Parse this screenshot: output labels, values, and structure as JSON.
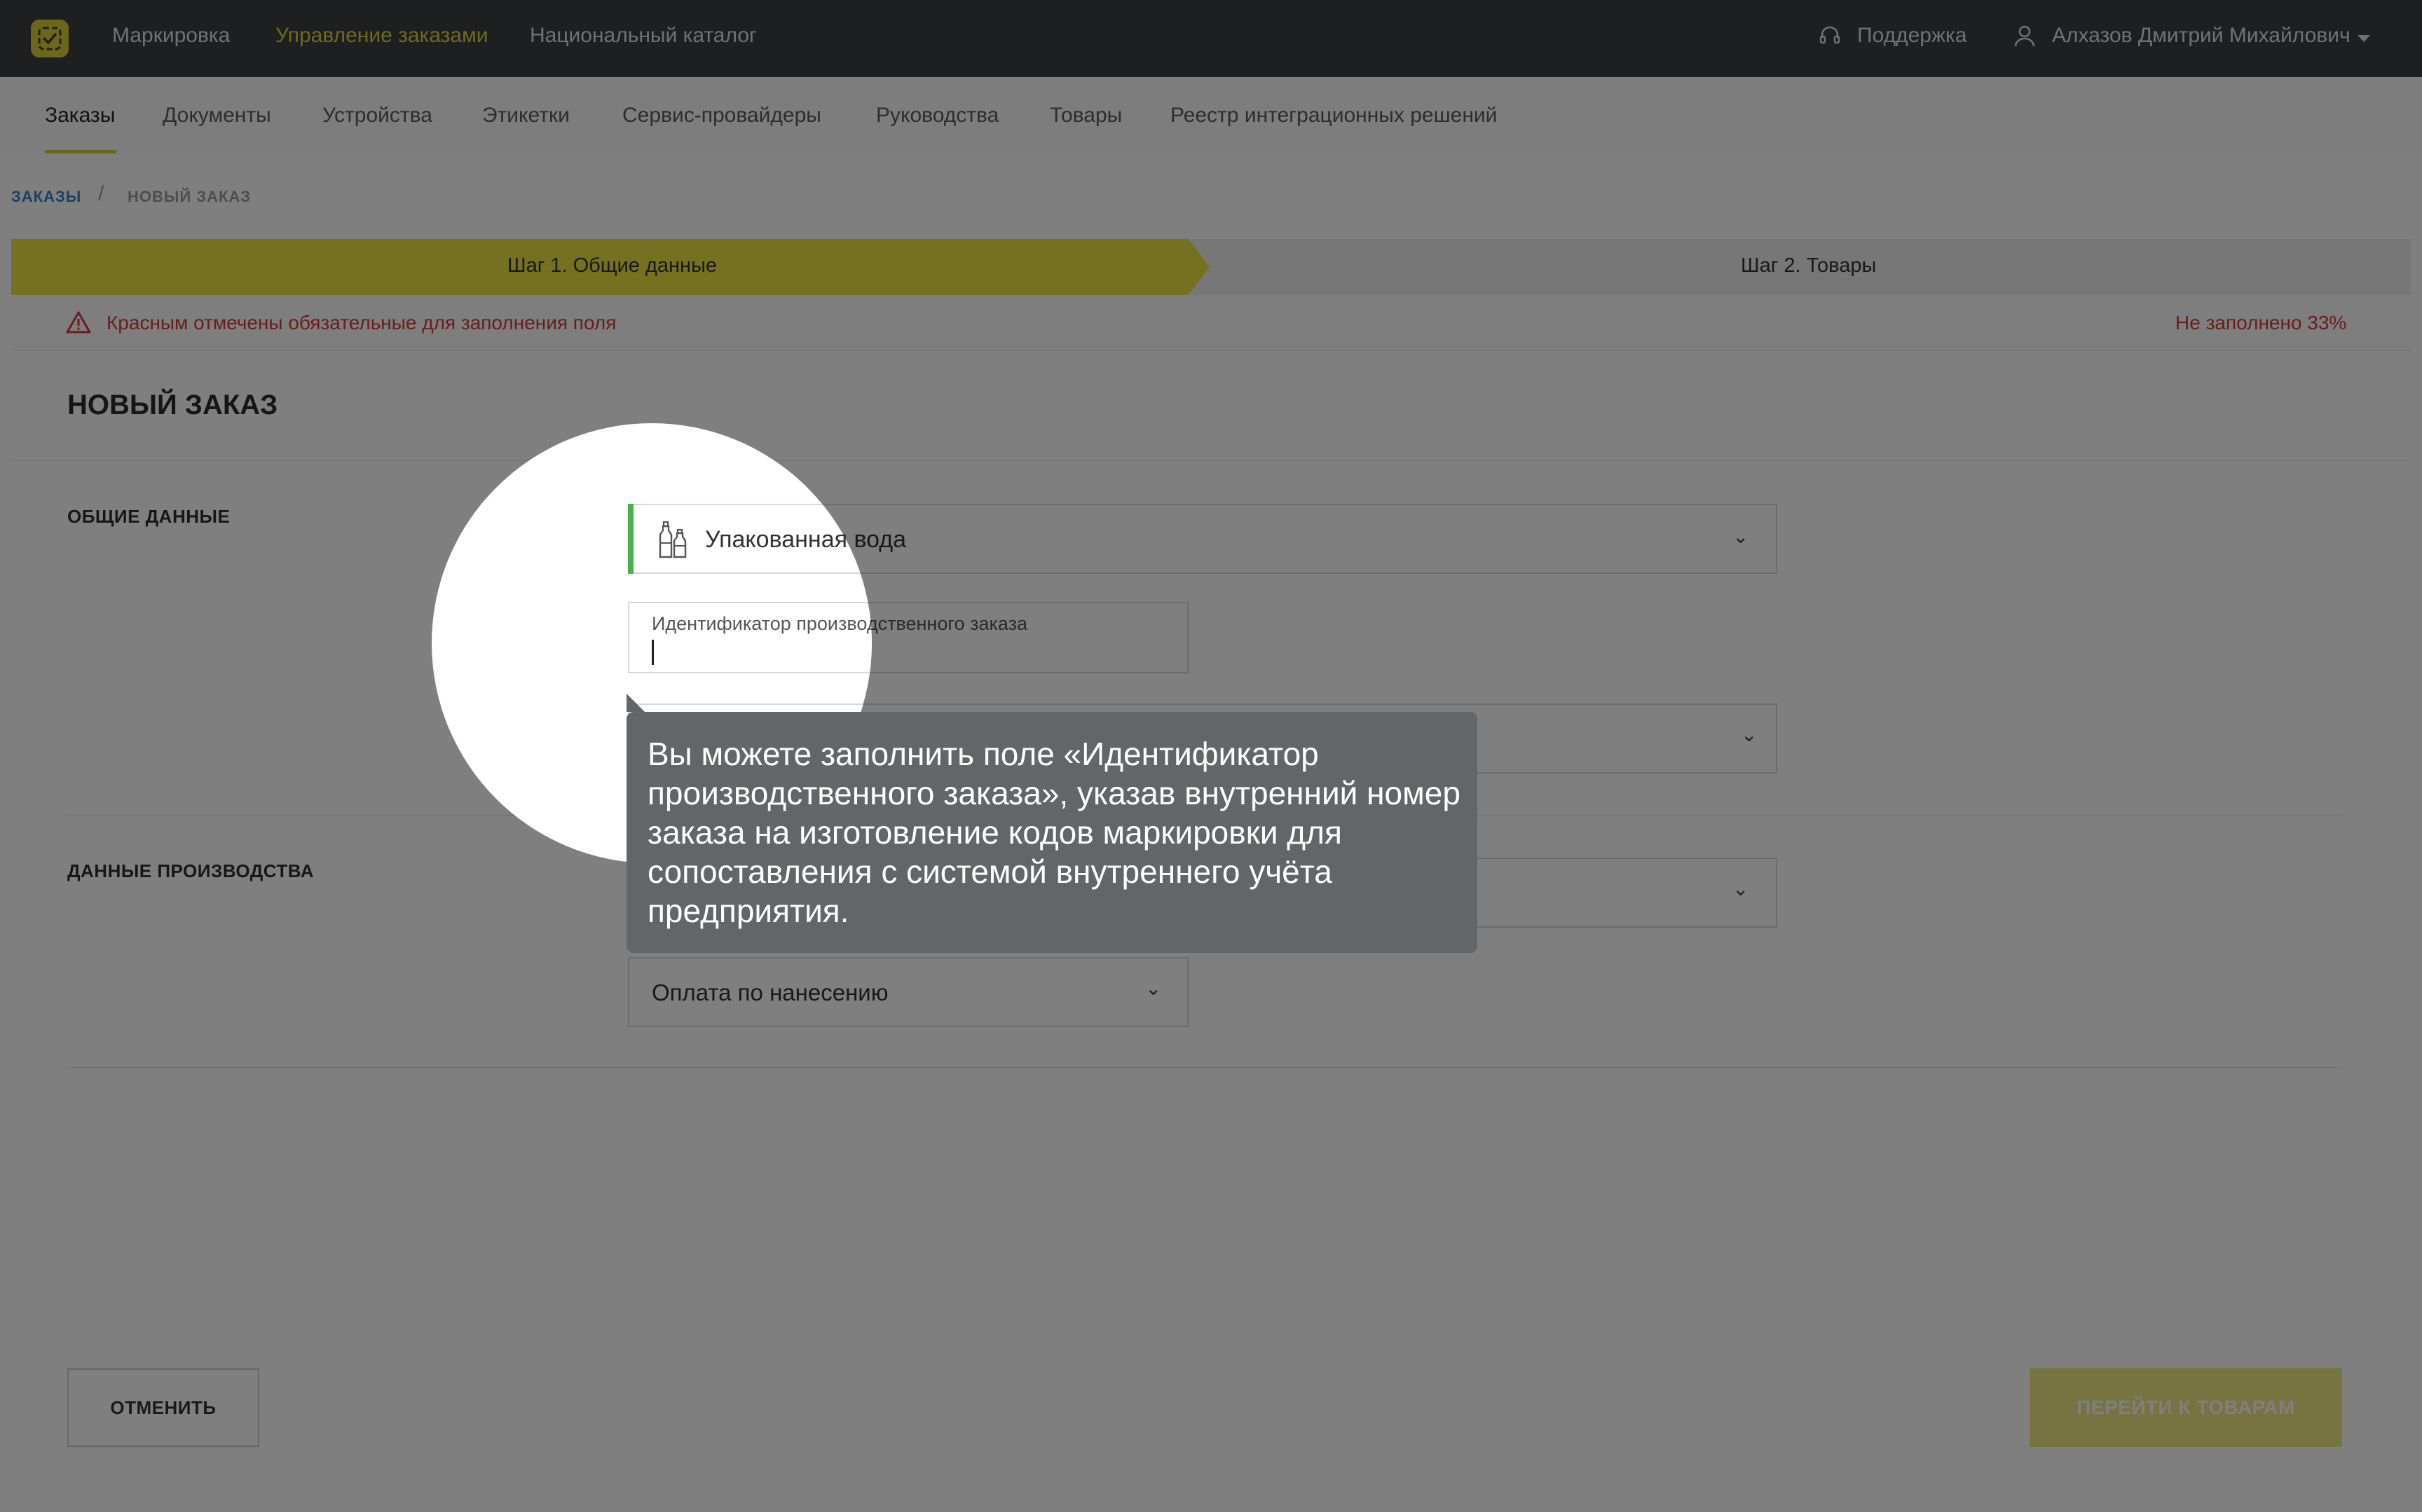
{
  "topbar": {
    "nav": [
      "Маркировка",
      "Управление заказами",
      "Национальный каталог"
    ],
    "support": "Поддержка",
    "user": "Алхазов Дмитрий Михайлович"
  },
  "subnav": [
    "Заказы",
    "Документы",
    "Устройства",
    "Этикетки",
    "Сервис-провайдеры",
    "Руководства",
    "Товары",
    "Реестр интеграционных решений"
  ],
  "breadcrumb": {
    "root": "ЗАКАЗЫ",
    "sep": "/",
    "current": "НОВЫЙ ЗАКАЗ"
  },
  "steps": {
    "step1": "Шаг 1. Общие данные",
    "step2": "Шаг 2. Товары"
  },
  "warning": {
    "text": "Красным отмечены обязательные для заполнения поля",
    "progress": "Не заполнено 33%"
  },
  "page_title": "НОВЫЙ ЗАКАЗ",
  "sections": {
    "general": "ОБЩИЕ ДАННЫЕ",
    "production": "ДАННЫЕ ПРОИЗВОДСТВА"
  },
  "fields": {
    "product_group": "Упакованная вода",
    "order_id_label": "Идентификатор производственного заказа",
    "payment_type": "Оплата по нанесению"
  },
  "buttons": {
    "cancel": "ОТМЕНИТЬ",
    "next": "ПЕРЕЙТИ К ТОВАРАМ"
  },
  "tooltip": "Вы можете заполнить поле «Идентификатор производственного заказа», указав внутренний номер заказа на изготовление кодов маркировки для сопоставления с системой внутреннего учёта предприятия.",
  "colors": {
    "accent": "#d9cf33",
    "topbar": "#3b3f43",
    "error": "#d33a3a",
    "ok": "#4caf50"
  }
}
